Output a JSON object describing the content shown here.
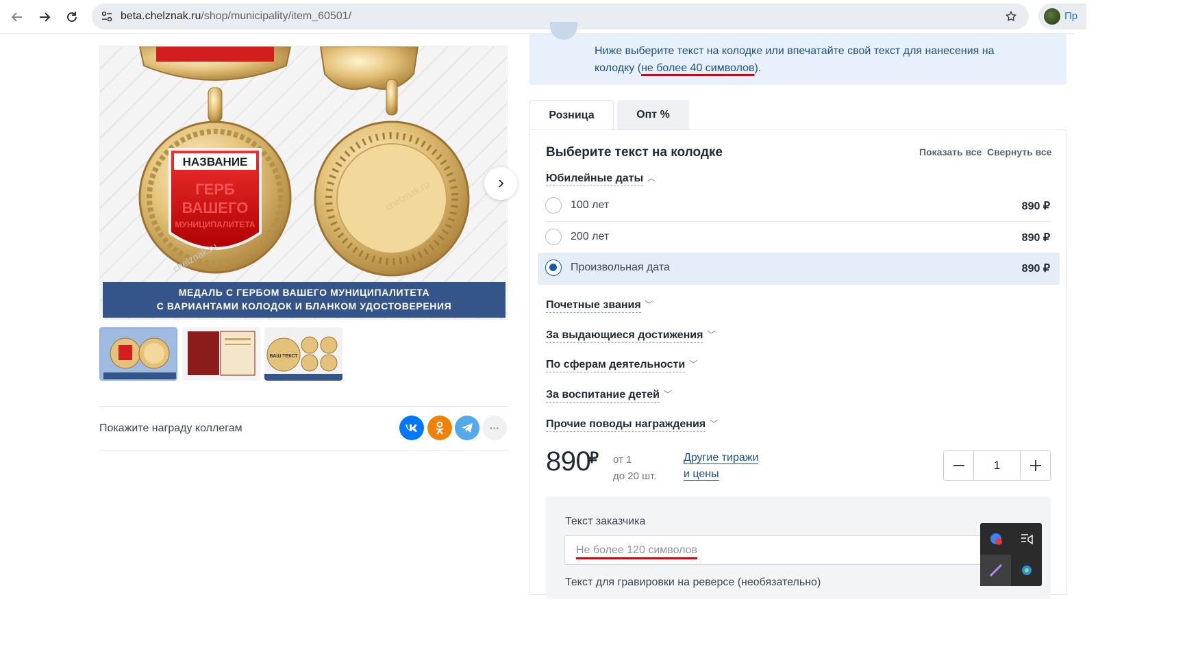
{
  "browser": {
    "url_host": "beta.chelznak.ru",
    "url_path": "/shop/municipality/item_60501/",
    "profile_label": "Пр"
  },
  "gallery": {
    "badge_text": "НАЗВАНИЕ",
    "emblem_text": [
      "ГЕРБ",
      "ВАШЕГО",
      "МУНИЦИПАЛИТЕТА"
    ],
    "watermark": "chelznak.ru",
    "banner_line1": "МЕДАЛЬ С ГЕРБОМ ВАШЕГО МУНИЦИПАЛИТЕТА",
    "banner_line2": "С ВАРИАНТАМИ КОЛОДОК И БЛАНКОМ УДОСТОВЕРЕНИЯ",
    "thumb3_text": "ВАШ ТЕКСТ"
  },
  "share": {
    "label": "Покажите награду коллегам",
    "buttons": [
      {
        "name": "vk",
        "glyph": "vk",
        "color": "#0077ff"
      },
      {
        "name": "ok",
        "glyph": "ok",
        "color": "#ee8208"
      },
      {
        "name": "telegram",
        "glyph": "tg",
        "color": "#54a9eb"
      },
      {
        "name": "more",
        "glyph": "···",
        "color": "#f0f1f3"
      }
    ]
  },
  "info": {
    "text_before": "Ниже выберите текст на колодке или впечатайте свой текст для нанесения на колодку (",
    "text_underlined": "не более 40 символов",
    "text_after": ")."
  },
  "tabs": [
    {
      "label": "Розница",
      "active": true
    },
    {
      "label": "Опт %",
      "active": false
    }
  ],
  "selector": {
    "title": "Выберите текст на колодке",
    "show_all": "Показать все",
    "collapse_all": "Свернуть все",
    "categories": [
      {
        "label": "Юбилейные даты",
        "expanded": true
      },
      {
        "label": "Почетные звания",
        "expanded": false
      },
      {
        "label": "За выдающиеся достижения",
        "expanded": false
      },
      {
        "label": "По сферам деятельности",
        "expanded": false
      },
      {
        "label": "За воспитание детей",
        "expanded": false
      },
      {
        "label": "Прочие поводы награждения",
        "expanded": false
      }
    ],
    "options": [
      {
        "label": "100 лет",
        "price": "890 ₽",
        "selected": false
      },
      {
        "label": "200 лет",
        "price": "890 ₽",
        "selected": false
      },
      {
        "label": "Произвольная дата",
        "price": "890 ₽",
        "selected": true
      }
    ]
  },
  "pricing": {
    "price": "890",
    "currency": "₽",
    "from_line1": "от 1",
    "from_line2": "до 20 шт.",
    "other_line1": "Другие тиражи",
    "other_line2": "и цены",
    "quantity": "1",
    "minus": "—",
    "plus": "+"
  },
  "custom_text": {
    "label": "Текст заказчика",
    "placeholder": "Не более 120 символов",
    "engrave_label": "Текст для гравировки на реверсе (необязательно)"
  },
  "colors": {
    "accent": "#1d4f86",
    "banner": "#34548a",
    "underline_red": "#d8000c",
    "info_bg": "#e8f1fb"
  }
}
